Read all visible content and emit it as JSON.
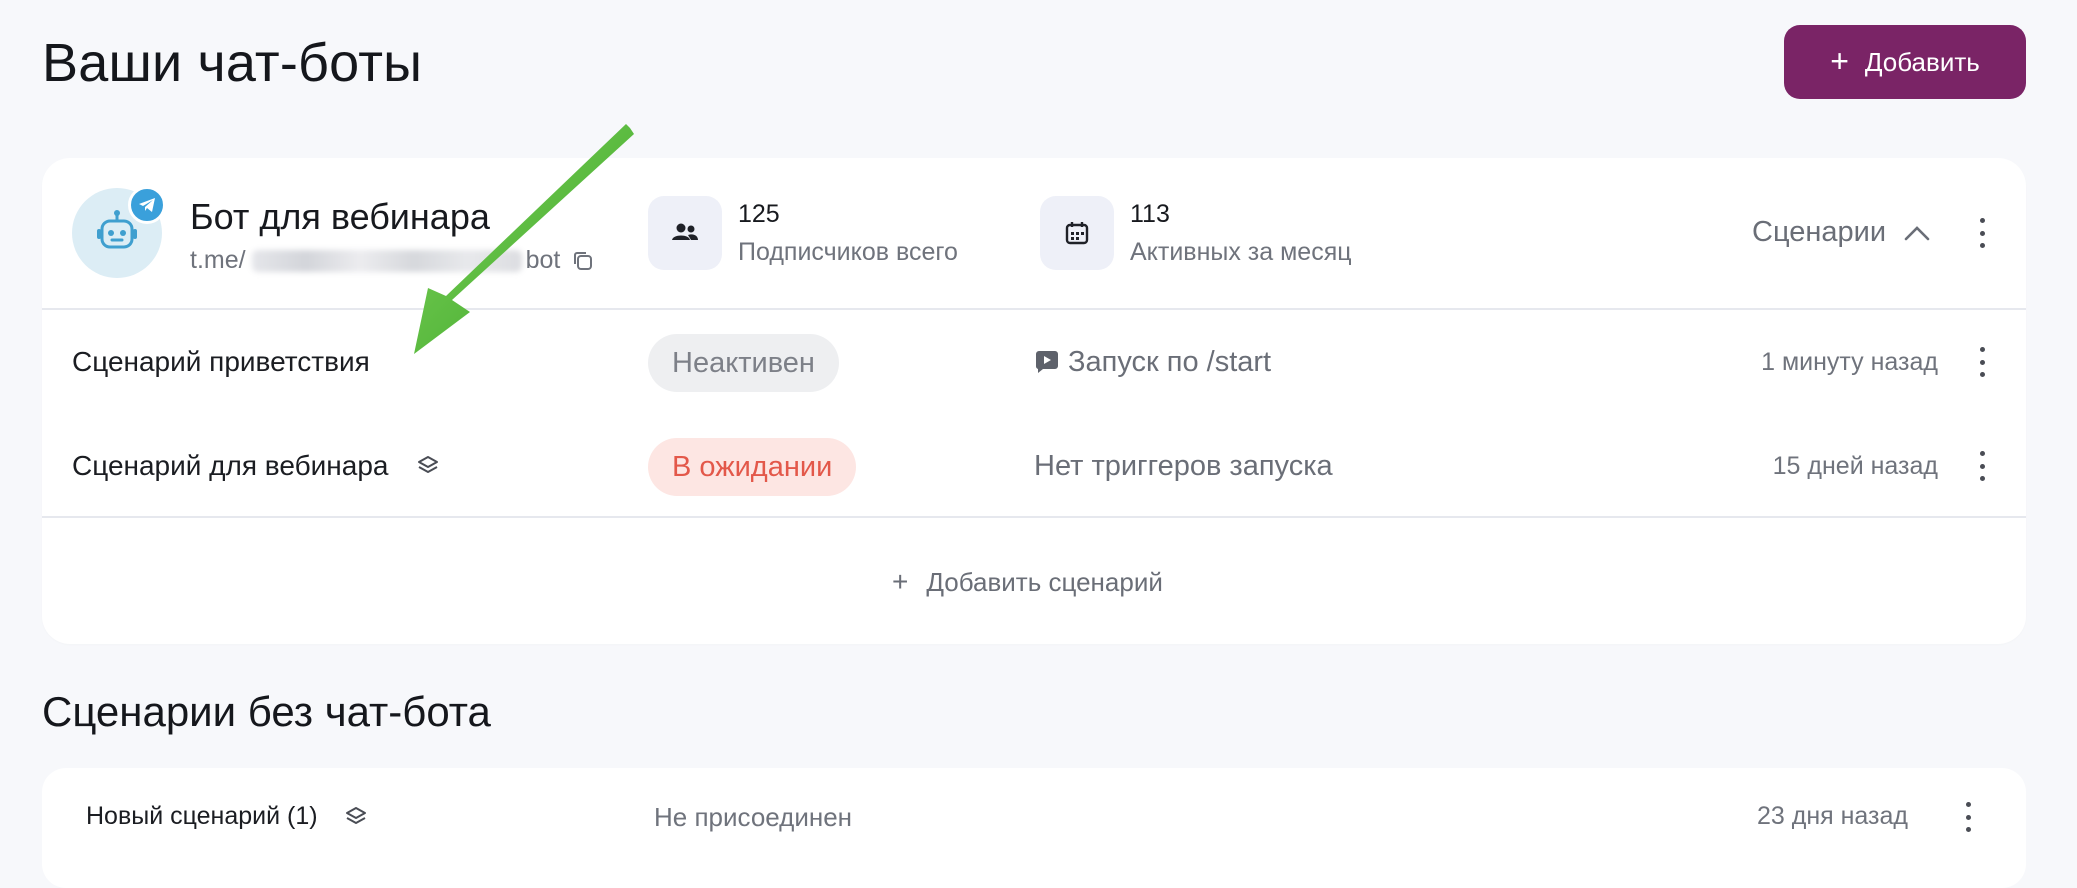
{
  "header": {
    "title": "Ваши чат-боты",
    "add_button": "Добавить"
  },
  "bot": {
    "name": "Бот для вебинара",
    "link_prefix": "t.me/",
    "link_suffix": "bot",
    "subscribers": {
      "value": "125",
      "label": "Подписчиков всего"
    },
    "active": {
      "value": "113",
      "label": "Активных за месяц"
    },
    "scenarios_toggle": "Сценарии"
  },
  "scenarios": [
    {
      "name": "Сценарий приветствия",
      "status": "Неактивен",
      "trigger": "Запуск по /start",
      "time": "1 минуту назад"
    },
    {
      "name": "Сценарий для вебинара",
      "status": "В ожидании",
      "trigger": "Нет триггеров запуска",
      "time": "15 дней назад"
    }
  ],
  "add_scenario": "Добавить сценарий",
  "unattached": {
    "title": "Сценарии без чат-бота",
    "items": [
      {
        "name": "Новый сценарий (1)",
        "status": "Не присоединен",
        "time": "23 дня назад"
      }
    ]
  },
  "colors": {
    "primary": "#7a2466",
    "pending_text": "#e3584a",
    "pending_bg": "#fde6e3",
    "telegram": "#3aa0db",
    "annotation_arrow": "#4cb832"
  },
  "icons": [
    "plus-icon",
    "robot-icon",
    "telegram-icon",
    "copy-icon",
    "users-icon",
    "calendar-icon",
    "chevron-up-icon",
    "kebab-icon",
    "play-icon",
    "layers-icon"
  ]
}
